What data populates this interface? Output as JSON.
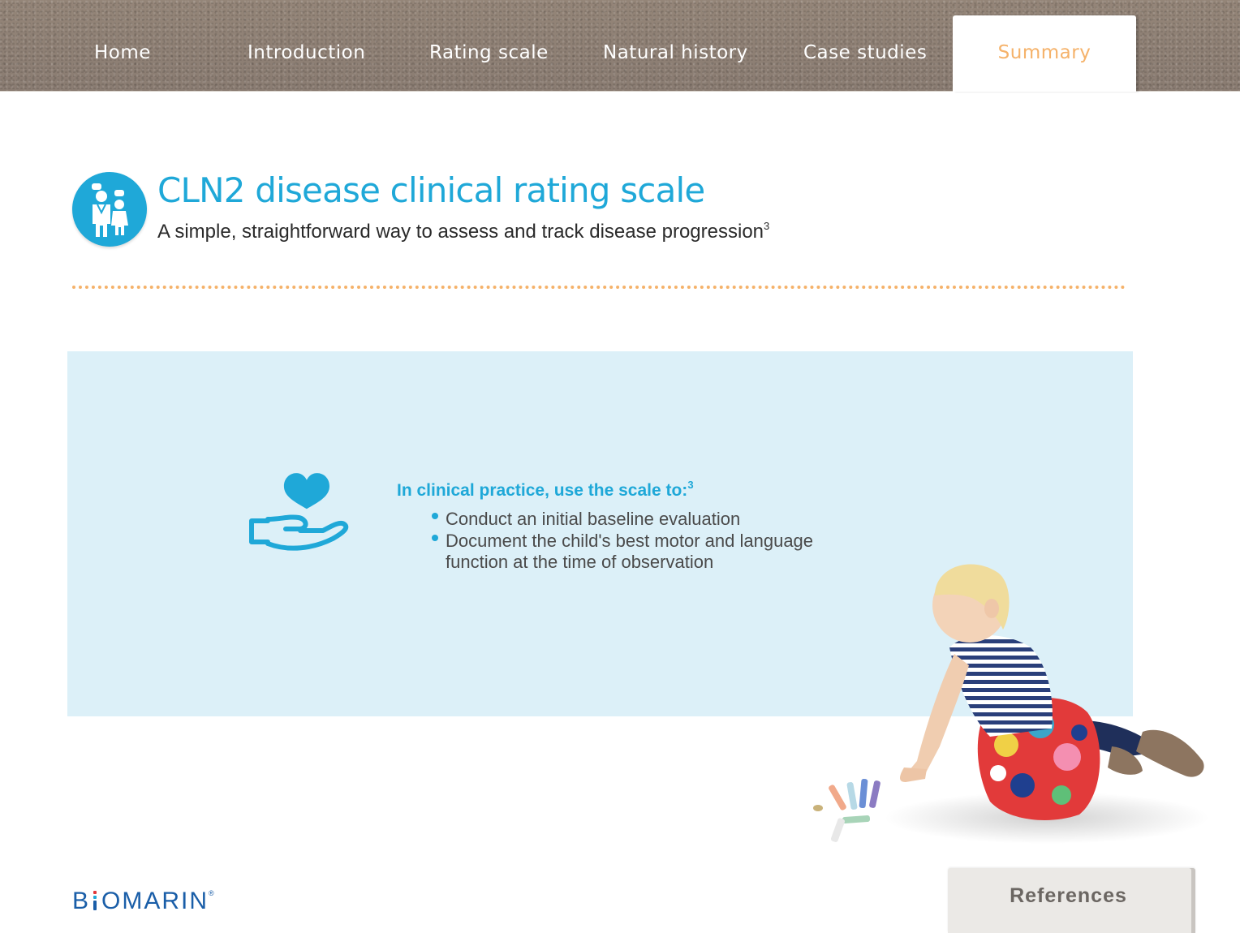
{
  "nav": {
    "items": [
      {
        "label": "Home"
      },
      {
        "label": "Introduction"
      },
      {
        "label": "Rating scale"
      },
      {
        "label": "Natural history"
      },
      {
        "label": "Case studies"
      }
    ],
    "active_label": "Summary"
  },
  "header": {
    "title": "CLN2 disease clinical rating scale",
    "subtitle": "A simple, straightforward way to assess and track disease progression",
    "subtitle_ref": "3",
    "icon": "family-doctor-icon"
  },
  "panel": {
    "icon": "heart-in-hand-icon",
    "heading": "In clinical practice, use the scale to:",
    "heading_ref": "3",
    "bullets": [
      "Conduct an initial baseline evaluation",
      "Document the child's best motor and language function at the time of observation"
    ]
  },
  "footer": {
    "logo": "BIOMARIN",
    "logo_mark": "®",
    "references_label": "References"
  },
  "colors": {
    "accent_blue": "#1fa8d8",
    "accent_orange": "#f5b26a",
    "panel_bg": "#dcf0f8",
    "logo_blue": "#1a5ea8"
  }
}
